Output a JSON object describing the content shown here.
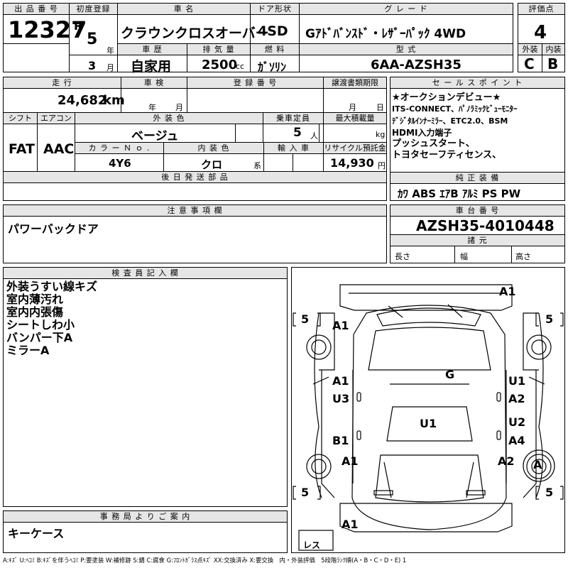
{
  "header": {
    "lot_label": "出 品 番 号",
    "lot_number": "12327",
    "first_reg_label": "初度登録",
    "era": "R",
    "year": "5",
    "year_unit": "年",
    "month": "3",
    "month_unit": "月",
    "car_name_label": "車 名",
    "car_name": "クラウンクロスオーバー",
    "door_label": "ドア形状",
    "door": "4SD",
    "grade_label": "グ レ ー ド",
    "grade": "Gｱﾄﾞﾊﾞﾝｽﾄﾞ・ﾚｻﾞｰﾊﾟｯｸ 4WD",
    "score_label": "評価点",
    "score": "4",
    "history_label": "車 歴",
    "history": "自家用",
    "displacement_label": "排 気 量",
    "displacement": "2500",
    "displacement_unit": "cc",
    "fuel_label": "燃 料",
    "fuel": "ｶﾞｿﾘﾝ",
    "model_label": "型 式",
    "model": "6AA-AZSH35",
    "ext_label": "外装",
    "ext_grade": "C",
    "int_label": "内装",
    "int_grade": "B"
  },
  "mid": {
    "mileage_label": "走 行",
    "mileage": "24,682",
    "mileage_unit": "km",
    "inspection_label": "車 検",
    "insp_year_unit": "年",
    "insp_month_unit": "月",
    "reg_no_label": "登 録 番 号",
    "transfer_label": "譲渡書類期限",
    "transfer_month_unit": "月",
    "transfer_day_unit": "日",
    "shift_label": "シフト",
    "shift": "FAT",
    "ac_label": "エアコン",
    "ac": "AAC",
    "ext_color_label": "外 装 色",
    "ext_color": "ベージュ",
    "capacity_label": "乗車定員",
    "capacity": "5",
    "capacity_unit": "人",
    "max_load_label": "最大積載量",
    "max_load_unit": "kg",
    "color_no_label": "カ ラ ー Ｎ ｏ .",
    "color_no": "4Y6",
    "int_color_label": "内 装 色",
    "int_color": "クロ",
    "int_color_unit": "系",
    "import_label": "輸 入 車",
    "recycle_label": "リサイクル預託金",
    "recycle": "14,930",
    "recycle_unit": "円",
    "later_parts_label": "後 日 発 送 部 品"
  },
  "sales_points": {
    "label": "セ ー ル ス ポ イ ン ト",
    "lines": [
      "★オークションデビュー★",
      "ITS-CONNECT、ﾊﾟﾉﾗﾐｯｸﾋﾞｭｰﾓﾆﾀｰ",
      "ﾃﾞｼﾞﾀﾙｲﾝﾅｰﾐﾗｰ、ETC2.0、BSM",
      "HDMI入力端子",
      "プッシュスタート、",
      "トヨタセーフティセンス、"
    ]
  },
  "equipment": {
    "label": "純 正 装 備",
    "items": "ｶﾜ ABS ｴｱB ｱﾙﾐ PS PW"
  },
  "notes": {
    "label": "注 意 事 項 欄",
    "text": "パワーバックドア"
  },
  "chassis": {
    "label": "車 台 番 号",
    "number": "AZSH35-4010448",
    "dims_label": "諸 元",
    "length_label": "長さ",
    "width_label": "幅",
    "height_label": "高さ"
  },
  "inspector": {
    "label": "検 査 員 記 入 欄",
    "lines": [
      "外装うすい線キズ",
      "室内薄汚れ",
      "室内内張傷",
      "シートしわ小",
      "バンパー下A",
      "ミラーA"
    ]
  },
  "office": {
    "label": "事 務 局 よ り ご 案 内",
    "text": "キーケース"
  },
  "diagram": {
    "marks": {
      "roof_top": "A1",
      "front_left_fender": "A1",
      "front_left_door": "A1",
      "front_left_door_2": "U3",
      "rear_left_door": "B1",
      "rear_left_quarter": "A1",
      "hood": "G",
      "roof": "U1",
      "right_front_door": "U1",
      "right_front_door_2": "A2",
      "right_rear_door": "U2",
      "right_rear_door_2": "A4",
      "right_rear_quarter": "A2",
      "spare_tire": "A",
      "rear_bottom": "A1"
    },
    "tires": {
      "front_left": "5",
      "front_right": "5",
      "rear_left": "5",
      "rear_right": "5"
    },
    "spare_label": "レス"
  },
  "footer": {
    "legend": "A:ｷｽﾞ U:ﾍｺﾐ B:ｷｽﾞを伴うﾍｺﾐ P:要塗装 W:補修跡 S:錆 C:腐食 G:ﾌﾛﾝﾄｶﾞﾗｽ点ｷｽﾞ XX:交換済み X:要交換　内・外装評価　5段階ﾗﾝｸ順(A・B・C・D・E) 1"
  }
}
